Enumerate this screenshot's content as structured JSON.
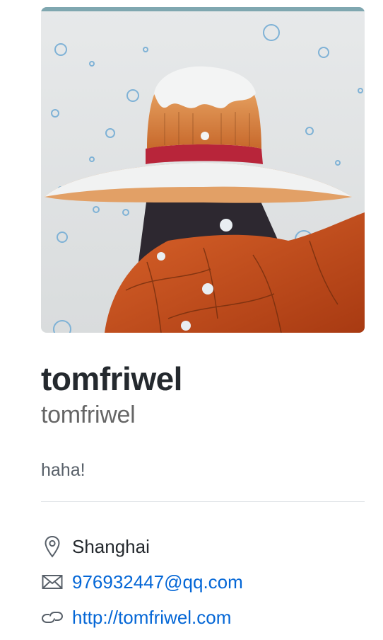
{
  "profile": {
    "avatar_icon": "user-avatar-illustration",
    "fullname": "tomfriwel",
    "username": "tomfriwel",
    "bio": "haha!"
  },
  "details": {
    "location": "Shanghai",
    "location_icon": "location-pin-icon",
    "email": "976932447@qq.com",
    "email_icon": "mail-icon",
    "url": "http://tomfriwel.com",
    "url_icon": "link-icon"
  },
  "colors": {
    "text": "#24292e",
    "secondary_text": "#666666",
    "bio_text": "#586069",
    "link": "#0366d6",
    "divider": "#e1e4e8"
  }
}
